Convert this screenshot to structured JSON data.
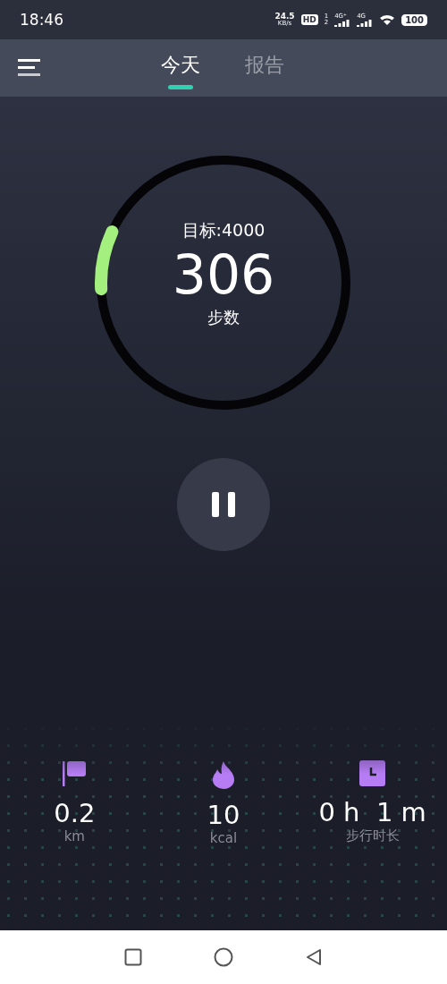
{
  "status_bar": {
    "time": "18:46",
    "speed": "24.5",
    "speed_unit": "KB/s",
    "hd": "HD",
    "hd_sup": "1",
    "hd_sub": "2",
    "network_1": "4G⁺",
    "network_2": "4G",
    "battery": "100"
  },
  "tabs": [
    {
      "label": "今天",
      "selected": true
    },
    {
      "label": "报告",
      "selected": false
    }
  ],
  "ring": {
    "goal": "目标:4000",
    "steps": "306",
    "unit": "步数",
    "level": 0.0765
  },
  "pause_button": {
    "paused": false
  },
  "stats": [
    {
      "kind": "distance",
      "value": "0.2",
      "unit": "km"
    },
    {
      "kind": "calories",
      "value": "10",
      "unit": "kcal"
    },
    {
      "kind": "duration",
      "value": "0 h  1 m",
      "unit": "步行时长"
    }
  ]
}
